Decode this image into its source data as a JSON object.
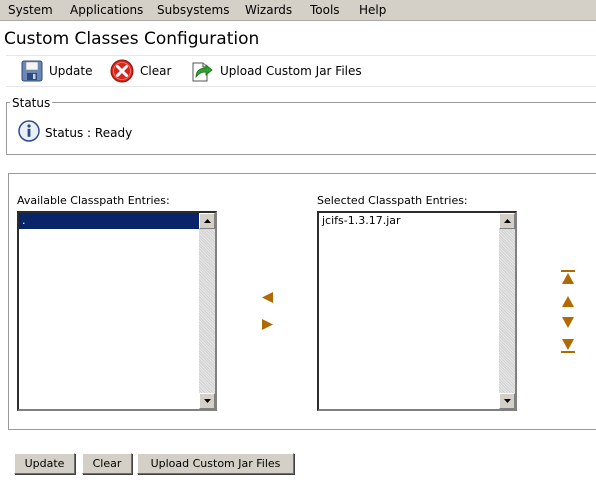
{
  "menu": {
    "items": [
      "System",
      "Applications",
      "Subsystems",
      "Wizards",
      "Tools",
      "Help"
    ]
  },
  "page": {
    "title": "Custom Classes Configuration"
  },
  "toolbar": {
    "update_label": "Update",
    "clear_label": "Clear",
    "upload_label": "Upload Custom Jar Files"
  },
  "status": {
    "legend": "Status",
    "text": "Status : Ready"
  },
  "classpath": {
    "available_label": "Available Classpath Entries:",
    "selected_label": "Selected Classpath Entries:",
    "available_items": [
      "."
    ],
    "available_selected_index": 0,
    "selected_items": [
      "jcifs-1.3.17.jar"
    ]
  },
  "buttons": {
    "update_label": "Update",
    "clear_label": "Clear",
    "upload_label": "Upload Custom Jar Files"
  },
  "colors": {
    "arrow_fill": "#b06a00",
    "selection": "#0a246a"
  },
  "icons": {
    "update": "floppy-disk-icon",
    "clear": "red-x-circle-icon",
    "upload": "document-green-arrow-icon",
    "status": "info-icon"
  }
}
